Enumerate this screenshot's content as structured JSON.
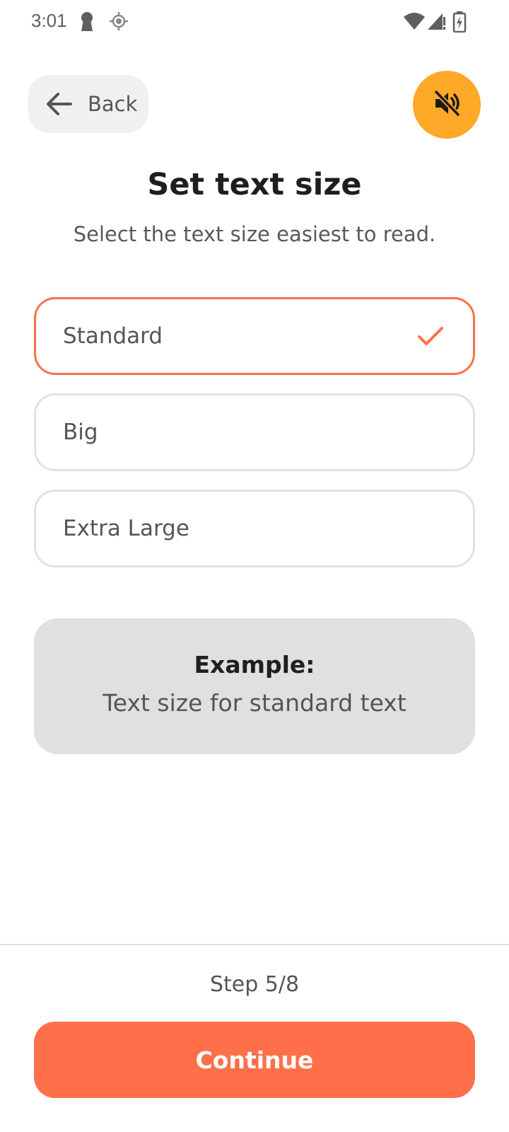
{
  "status_bar": {
    "time": "3:01",
    "left_icons": [
      "keyhole-icon",
      "location-icon"
    ],
    "right_icons": [
      "wifi-icon",
      "cell-signal-icon",
      "battery-charging-icon"
    ]
  },
  "header": {
    "back_label": "Back",
    "back_icon": "arrow-left-icon",
    "mute_icon": "volume-off-icon"
  },
  "page": {
    "title": "Set text size",
    "subtitle": "Select the text size easiest to read."
  },
  "options": [
    {
      "label": "Standard",
      "selected": true
    },
    {
      "label": "Big",
      "selected": false
    },
    {
      "label": "Extra Large",
      "selected": false
    }
  ],
  "example": {
    "heading": "Example:",
    "text": "Text size for standard text"
  },
  "footer": {
    "step": "Step 5/8",
    "continue_label": "Continue"
  },
  "colors": {
    "accent": "#ff6f4a",
    "mute_button": "#ffa928",
    "example_bg": "#e0e0e0"
  }
}
